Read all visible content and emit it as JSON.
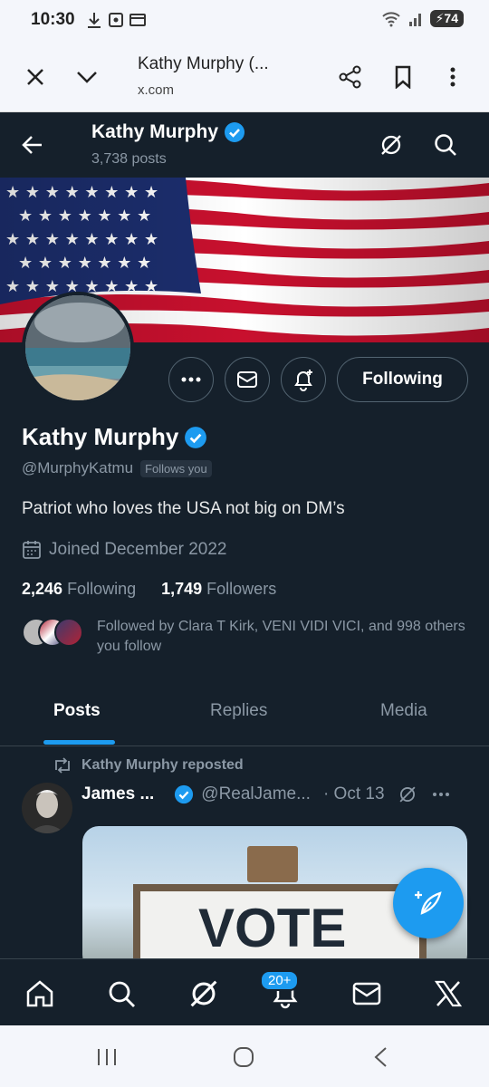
{
  "status_bar": {
    "time": "10:30",
    "battery": "74"
  },
  "browser": {
    "title": "Kathy Murphy (...",
    "url": "x.com"
  },
  "header": {
    "name": "Kathy Murphy",
    "posts": "3,738 posts"
  },
  "profile": {
    "name": "Kathy Murphy",
    "handle": "@MurphyKatmu",
    "follows_you": "Follows you",
    "bio": "Patriot who loves the USA not big on DM’s",
    "joined": "Joined December 2022",
    "following_count": "2,246",
    "following_label": "Following",
    "followers_count": "1,749",
    "followers_label": "Followers",
    "followed_by": "Followed by Clara T Kirk, VENI VIDI VICI, and 998 others you follow",
    "following_button": "Following"
  },
  "tabs": [
    "Posts",
    "Replies",
    "Media"
  ],
  "tweet": {
    "repost_label": "Kathy Murphy reposted",
    "name": "James ...",
    "handle": "@RealJame...",
    "date": "· Oct 13",
    "image_text": "VOTE"
  },
  "bottom_nav": {
    "notifications_badge": "20+"
  },
  "colors": {
    "bg": "#15202b",
    "accent": "#1d9bf0",
    "muted": "#8b98a5"
  }
}
